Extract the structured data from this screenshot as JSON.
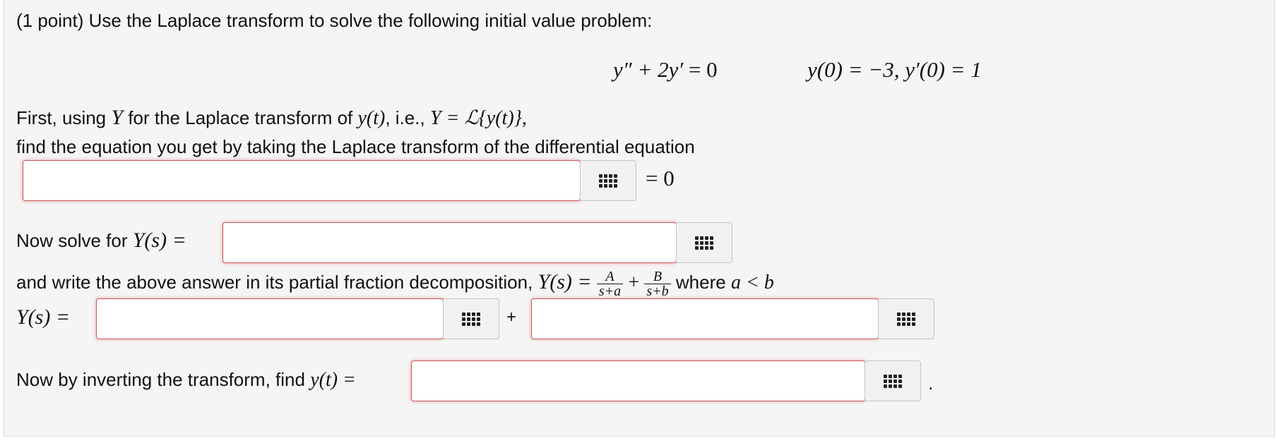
{
  "problem": {
    "intro": "(1 point) Use the Laplace transform to solve the following initial value problem:",
    "ode": {
      "lhs": "y″ + 2y′",
      "eq": "= 0",
      "ic": "y(0) = −3,  y′(0) = 1"
    }
  },
  "step1": {
    "text_a": "First, using",
    "Y": "Y",
    "text_b": "for the Laplace transform of",
    "yt": "y(t)",
    "text_c": ", i.e.,",
    "def": "Y = ℒ{y(t)},",
    "line2": "find the equation you get by taking the Laplace transform of the differential equation",
    "after_box": "= 0"
  },
  "step2": {
    "label": "Now solve for",
    "Ys": "Y(s) ="
  },
  "step3": {
    "text": "and write the above answer in its partial fraction decomposition,",
    "Ys": "Y(s) =",
    "frac1_num": "A",
    "frac1_den": "s+a",
    "plus": "+",
    "frac2_num": "B",
    "frac2_den": "s+b",
    "where": "where",
    "cond": "a < b",
    "row_label": "Y(s) =",
    "between_plus": "+"
  },
  "step4": {
    "label": "Now by inverting the transform, find",
    "yt": "y(t) =",
    "end_period": "."
  },
  "answers": {
    "transformed_eq": "",
    "Y_solution": "",
    "pf_term1": "",
    "pf_term2": "",
    "y_solution": ""
  },
  "icons": {
    "palette": "math-palette-grid-icon"
  },
  "colors": {
    "panel_bg": "#f5f5f5",
    "box_border": "#cc5555"
  }
}
